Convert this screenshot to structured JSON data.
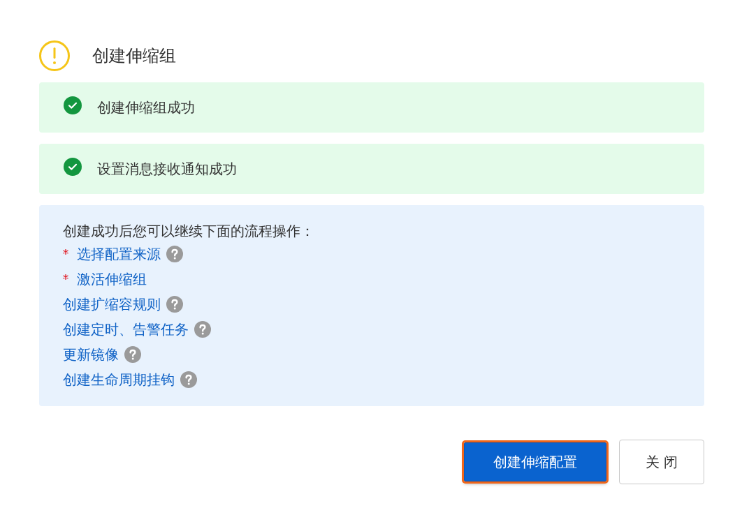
{
  "dialog": {
    "title": "创建伸缩组"
  },
  "results": [
    {
      "text": "创建伸缩组成功",
      "kind": "success"
    },
    {
      "text": "设置消息接收通知成功",
      "kind": "success"
    }
  ],
  "next_steps": {
    "intro": "创建成功后您可以继续下面的流程操作：",
    "items": [
      {
        "label": "选择配置来源",
        "required": true,
        "help": true
      },
      {
        "label": "激活伸缩组",
        "required": true,
        "help": false
      },
      {
        "label": "创建扩缩容规则",
        "required": false,
        "help": true
      },
      {
        "label": "创建定时、告警任务",
        "required": false,
        "help": true
      },
      {
        "label": "更新镜像",
        "required": false,
        "help": true
      },
      {
        "label": "创建生命周期挂钩",
        "required": false,
        "help": true
      }
    ]
  },
  "buttons": [
    {
      "label": "创建伸缩配置",
      "kind": "primary",
      "highlighted": true
    },
    {
      "label": "关 闭",
      "kind": "secondary",
      "highlighted": false
    }
  ]
}
